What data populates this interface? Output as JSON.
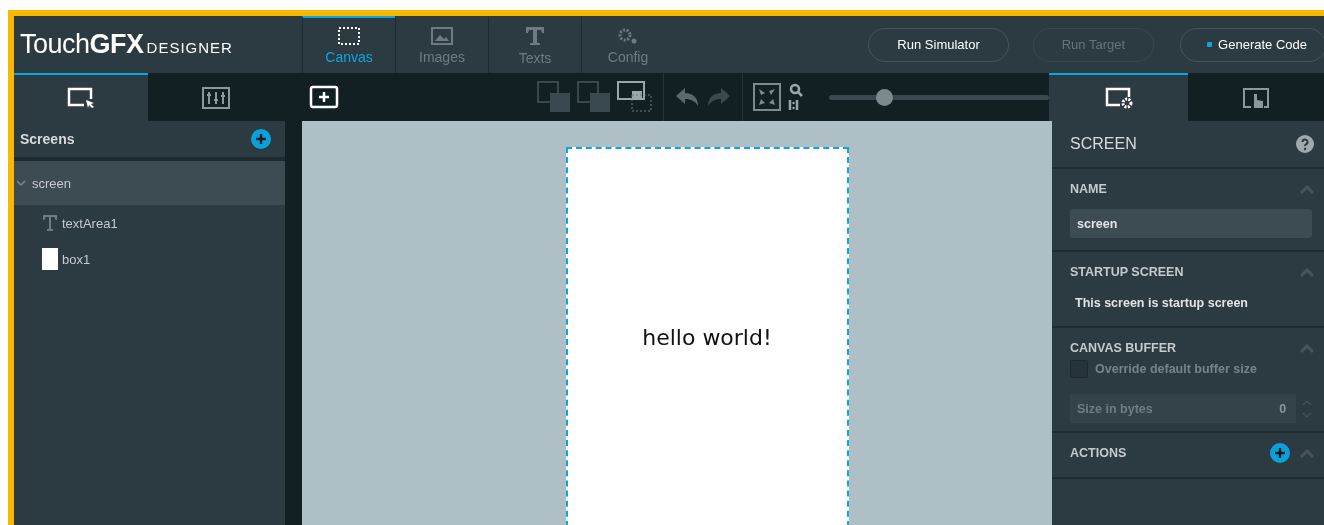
{
  "logo": {
    "name": "Touch**GFX**",
    "suffix": "DESIGNER"
  },
  "nav_tabs": [
    {
      "label": "Canvas",
      "selected": true
    },
    {
      "label": "Images",
      "selected": false
    },
    {
      "label": "Texts",
      "selected": false
    },
    {
      "label": "Config",
      "selected": false
    }
  ],
  "actions": [
    {
      "label": "Run Simulator",
      "disabled": false,
      "dot": false
    },
    {
      "label": "Run Target",
      "disabled": true,
      "dot": false
    },
    {
      "label": "Generate Code",
      "disabled": false,
      "dot": true
    }
  ],
  "left_tabs": [
    {
      "selected": true
    },
    {
      "selected": false
    }
  ],
  "toolbar": {
    "zoom": {
      "level": 0.25
    }
  },
  "right_tabs": [
    {
      "selected": true
    },
    {
      "selected": false
    }
  ],
  "screens": {
    "title": "Screens",
    "tree": [
      {
        "label": "screen",
        "expanded": true,
        "selected": true,
        "children": [
          {
            "label": "textArea1",
            "kind": "text"
          },
          {
            "label": "box1",
            "kind": "box"
          }
        ]
      }
    ]
  },
  "canvas": {
    "text": "hello world!"
  },
  "properties": {
    "title": "SCREEN",
    "name": {
      "title": "NAME",
      "value": "screen"
    },
    "startup": {
      "title": "STARTUP SCREEN",
      "text": "This screen is startup screen"
    },
    "buffer": {
      "title": "CANVAS BUFFER",
      "checkbox": "Override default buffer size",
      "checked": false,
      "size_placeholder": "Size in bytes",
      "size_value": "0"
    },
    "actions": {
      "title": "ACTIONS"
    }
  }
}
